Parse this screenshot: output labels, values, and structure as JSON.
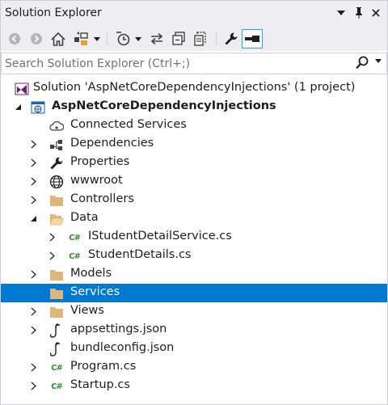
{
  "window": {
    "title": "Solution Explorer"
  },
  "toolbar": {
    "items": [
      "back-icon",
      "forward-icon",
      "home-icon",
      "switch-views-icon",
      "pending-changes-filter-icon",
      "sync-icon",
      "collapse-all-icon",
      "show-all-files-icon",
      "properties-icon",
      "preview-icon"
    ]
  },
  "search": {
    "placeholder": "Search Solution Explorer (Ctrl+;)"
  },
  "tree": {
    "solution": "Solution 'AspNetCoreDependencyInjections' (1 project)",
    "project": "AspNetCoreDependencyInjections",
    "items": [
      {
        "label": "Connected Services",
        "icon": "cloud-icon"
      },
      {
        "label": "Dependencies",
        "icon": "dependencies-icon"
      },
      {
        "label": "Properties",
        "icon": "wrench-icon"
      },
      {
        "label": "wwwroot",
        "icon": "globe-icon"
      },
      {
        "label": "Controllers",
        "icon": "folder-icon"
      },
      {
        "label": "Data",
        "icon": "folder-open-icon"
      },
      {
        "label": "IStudentDetailService.cs",
        "icon": "csharp-file-icon"
      },
      {
        "label": "StudentDetails.cs",
        "icon": "csharp-file-icon"
      },
      {
        "label": "Models",
        "icon": "folder-icon"
      },
      {
        "label": "Services",
        "icon": "folder-icon"
      },
      {
        "label": "Views",
        "icon": "folder-icon"
      },
      {
        "label": "appsettings.json",
        "icon": "json-file-icon"
      },
      {
        "label": "bundleconfig.json",
        "icon": "json-file-icon"
      },
      {
        "label": "Program.cs",
        "icon": "csharp-file-icon"
      },
      {
        "label": "Startup.cs",
        "icon": "csharp-file-icon"
      }
    ],
    "selected": "Services"
  },
  "colors": {
    "chrome": "#eeeef2",
    "selection": "#0079d3",
    "folder": "#dcb67a",
    "csharp": "#388a34"
  }
}
